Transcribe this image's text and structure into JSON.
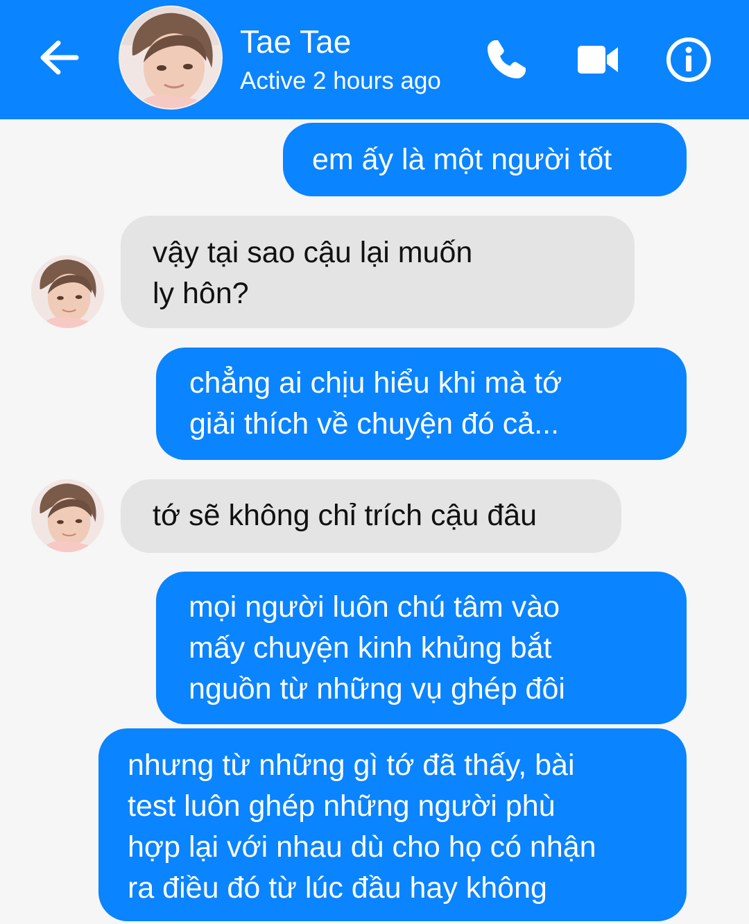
{
  "header": {
    "contact_name": "Tae Tae",
    "status": "Active 2 hours ago",
    "bg_color": "#0a84ff"
  },
  "icons": {
    "back": "arrow-left",
    "call": "phone",
    "video": "video-camera",
    "info": "info-circle"
  },
  "colors": {
    "outgoing_bubble": "#0a84ff",
    "incoming_bubble": "#e4e4e4",
    "background": "#f6f6f6"
  },
  "messages": [
    {
      "direction": "outgoing",
      "lines": [
        "em ấy là một người tốt"
      ]
    },
    {
      "direction": "incoming",
      "lines": [
        "vậy tại sao cậu lại muốn",
        "ly hôn?"
      ]
    },
    {
      "direction": "outgoing",
      "lines": [
        "chẳng ai chịu hiểu khi mà tớ",
        "giải thích về chuyện đó cả..."
      ]
    },
    {
      "direction": "incoming",
      "lines": [
        "tớ sẽ không chỉ trích cậu đâu"
      ]
    },
    {
      "direction": "outgoing",
      "lines": [
        "mọi người luôn chú tâm vào",
        "mấy chuyện kinh khủng bắt",
        "nguồn từ những vụ ghép đôi"
      ]
    },
    {
      "direction": "outgoing",
      "lines": [
        "nhưng từ những gì tớ đã thấy, bài",
        "test luôn ghép những người phù",
        "hợp lại với nhau dù cho họ có nhận",
        "ra điều đó từ lúc đầu hay không"
      ]
    }
  ]
}
